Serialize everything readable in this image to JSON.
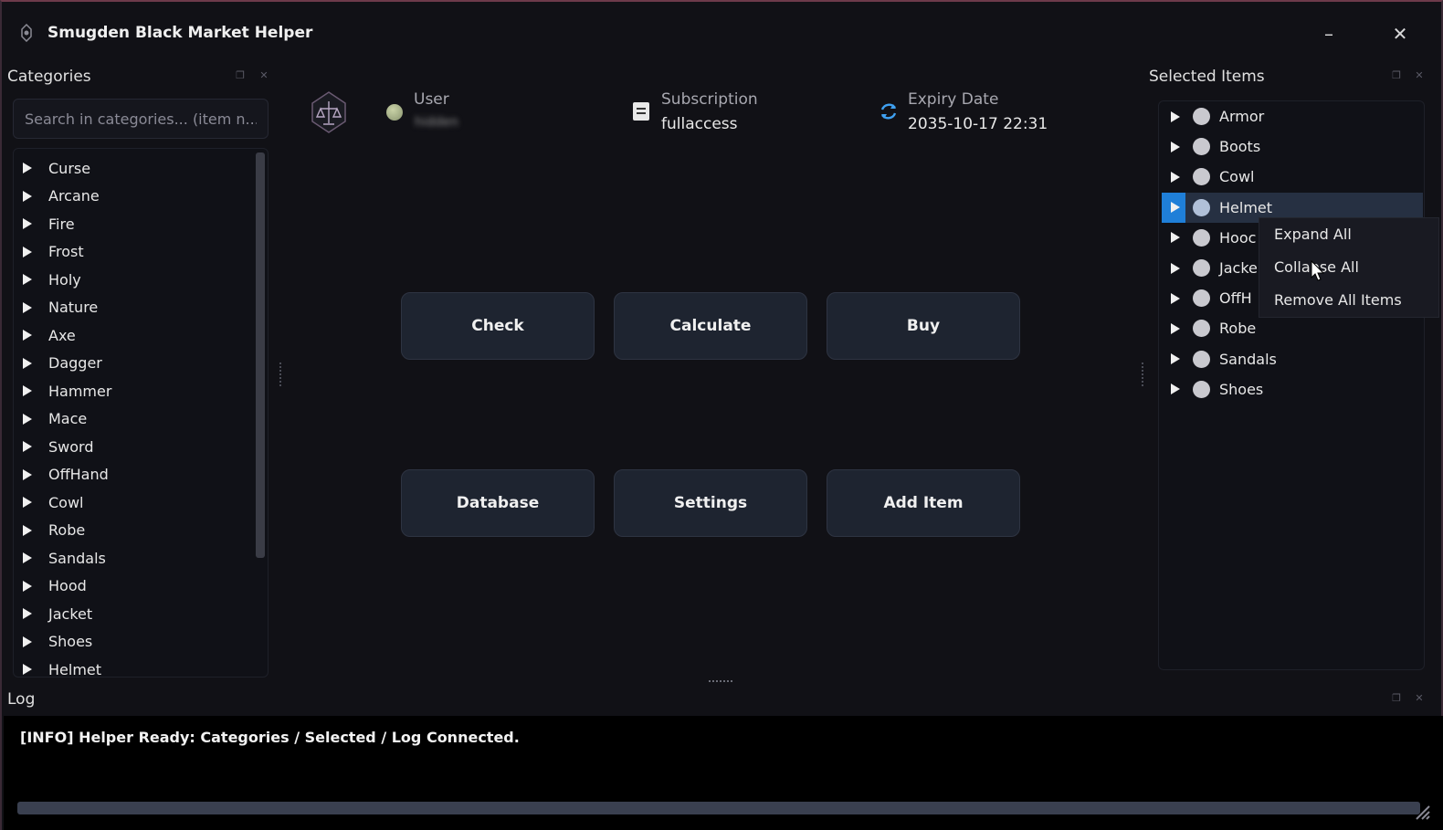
{
  "window": {
    "title": "Smugden Black Market Helper",
    "minimize": "–",
    "close": "✕"
  },
  "categories": {
    "title": "Categories",
    "search_placeholder": "Search in categories... (item n...",
    "items": [
      "Curse",
      "Arcane",
      "Fire",
      "Frost",
      "Holy",
      "Nature",
      "Axe",
      "Dagger",
      "Hammer",
      "Mace",
      "Sword",
      "OffHand",
      "Cowl",
      "Robe",
      "Sandals",
      "Hood",
      "Jacket",
      "Shoes",
      "Helmet"
    ]
  },
  "info": {
    "user_label": "User",
    "user_value": "hidden",
    "subscription_label": "Subscription",
    "subscription_value": "fullaccess",
    "expiry_label": "Expiry Date",
    "expiry_value": "2035-10-17 22:31"
  },
  "buttons": {
    "check": "Check",
    "calculate": "Calculate",
    "buy": "Buy",
    "database": "Database",
    "settings": "Settings",
    "add_item": "Add Item"
  },
  "selected": {
    "title": "Selected Items",
    "items": [
      "Armor",
      "Boots",
      "Cowl",
      "Helmet",
      "Hooc",
      "Jacke",
      "OffH",
      "Robe",
      "Sandals",
      "Shoes"
    ],
    "selected_index": 3
  },
  "context_menu": {
    "expand_all": "Expand All",
    "collapse_all": "Collapse All",
    "remove_all": "Remove All Items"
  },
  "log": {
    "title": "Log",
    "line": "[INFO] Helper Ready: Categories / Selected / Log Connected."
  },
  "colors": {
    "background": "#111116",
    "button": "#1e2430",
    "selection": "#263042",
    "accent": "#1f7fd8"
  }
}
